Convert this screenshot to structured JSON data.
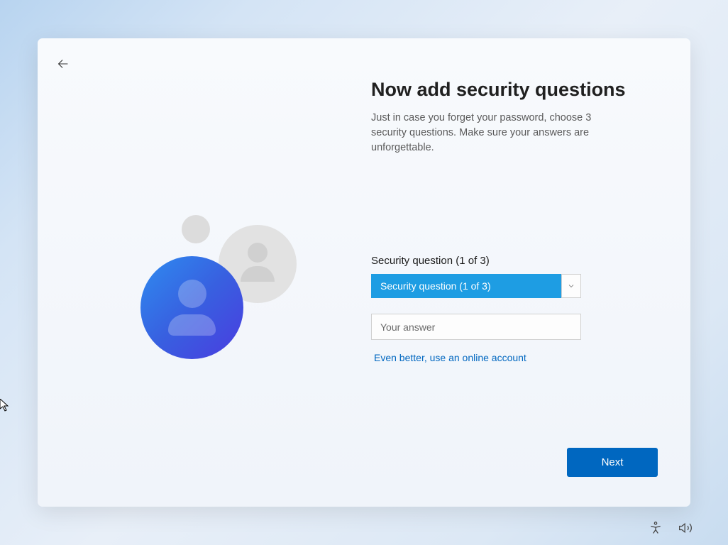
{
  "page": {
    "title": "Now add security questions",
    "description": "Just in case you forget your password, choose 3 security questions. Make sure your answers are unforgettable."
  },
  "form": {
    "question_label": "Security question (1 of 3)",
    "dropdown_selected": "Security question (1 of 3)",
    "answer_placeholder": "Your answer",
    "online_account_link": "Even better, use an online account"
  },
  "buttons": {
    "next": "Next"
  }
}
